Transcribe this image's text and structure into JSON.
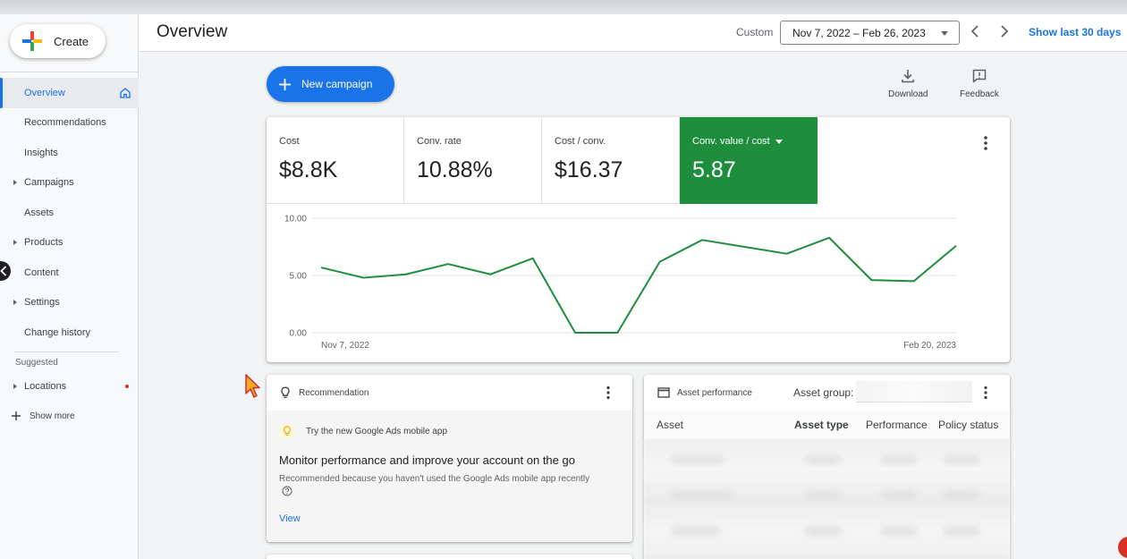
{
  "sidebar": {
    "create_label": "Create",
    "items": [
      {
        "label": "Overview",
        "active": true,
        "caret": false
      },
      {
        "label": "Recommendations",
        "active": false,
        "caret": false
      },
      {
        "label": "Insights",
        "active": false,
        "caret": false
      },
      {
        "label": "Campaigns",
        "active": false,
        "caret": true
      },
      {
        "label": "Assets",
        "active": false,
        "caret": false
      },
      {
        "label": "Products",
        "active": false,
        "caret": true
      },
      {
        "label": "Content",
        "active": false,
        "caret": false
      },
      {
        "label": "Settings",
        "active": false,
        "caret": true
      },
      {
        "label": "Change history",
        "active": false,
        "caret": false
      }
    ],
    "suggested_label": "Suggested",
    "suggested_items": [
      {
        "label": "Locations",
        "caret": true,
        "dot": true
      }
    ],
    "show_more_label": "Show more"
  },
  "header": {
    "title": "Overview",
    "date_mode": "Custom",
    "date_range": "Nov 7, 2022 – Feb 26, 2023",
    "show_last_label": "Show last 30 days"
  },
  "actions": {
    "new_campaign_label": "New campaign",
    "download_label": "Download",
    "feedback_label": "Feedback"
  },
  "metrics": [
    {
      "name": "Cost",
      "value": "$8.8K",
      "selected": false
    },
    {
      "name": "Conv. rate",
      "value": "10.88%",
      "selected": false
    },
    {
      "name": "Cost / conv.",
      "value": "$16.37",
      "selected": false
    },
    {
      "name": "Conv. value / cost",
      "value": "5.87",
      "selected": true
    }
  ],
  "chart_data": {
    "type": "line",
    "series": [
      {
        "values": [
          5.7,
          4.8,
          5.1,
          6.0,
          5.1,
          6.5,
          0.0,
          0.0,
          6.2,
          8.1,
          7.5,
          6.9,
          8.3,
          4.6,
          4.5,
          7.6
        ]
      }
    ],
    "x_tick_labels": [
      "Nov 7, 2022",
      "Feb 20, 2023"
    ],
    "y_ticks": [
      "0.00",
      "5.00",
      "10.00"
    ],
    "ylim": [
      0,
      10
    ],
    "grid": true,
    "color": "#1e8e3e"
  },
  "recommendation": {
    "header": "Recommendation",
    "tip": "Try the new Google Ads mobile app",
    "title": "Monitor performance and improve your account on the go",
    "reason": "Recommended because you haven't used the Google Ads mobile app recently",
    "view_label": "View"
  },
  "asset_performance": {
    "header": "Asset performance",
    "group_label": "Asset group:",
    "columns": [
      "Asset",
      "Asset type",
      "Performance",
      "Policy status"
    ]
  },
  "colors": {
    "accent": "#1a73e8",
    "selected_metric": "#1e8e3e"
  }
}
